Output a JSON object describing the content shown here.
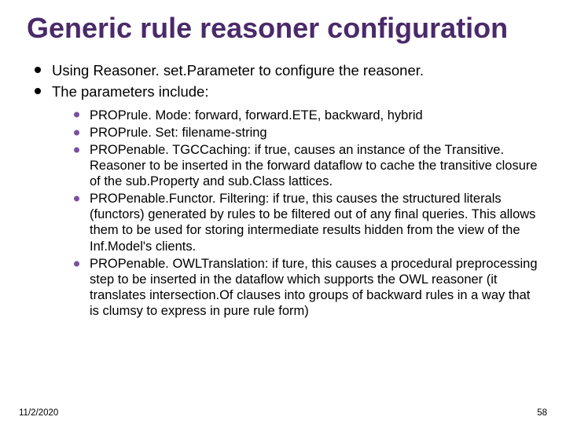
{
  "title": "Generic rule reasoner configuration",
  "bullets": {
    "b0": "Using Reasoner. set.Parameter to configure the reasoner.",
    "b1": "The parameters include:"
  },
  "sub": {
    "s0": "PROPrule. Mode: forward, forward.ETE, backward, hybrid",
    "s1": "PROPrule. Set: filename-string",
    "s2": "PROPenable. TGCCaching: if true, causes an instance of the Transitive. Reasoner to be inserted in the forward dataflow to cache the transitive closure of the sub.Property and sub.Class lattices.",
    "s3": "PROPenable.Functor. Filtering: if true, this causes the structured literals (functors) generated by rules to be filtered out of any final queries. This allows them to be used for storing intermediate results hidden from the view of the Inf.Model's clients.",
    "s4": "PROPenable. OWLTranslation: if ture, this causes a procedural preprocessing step to be inserted in the dataflow which supports the OWL reasoner (it translates intersection.Of clauses into groups of backward rules in a way that is clumsy to express in pure rule form)"
  },
  "footer": {
    "date": "11/2/2020",
    "page": "58"
  }
}
